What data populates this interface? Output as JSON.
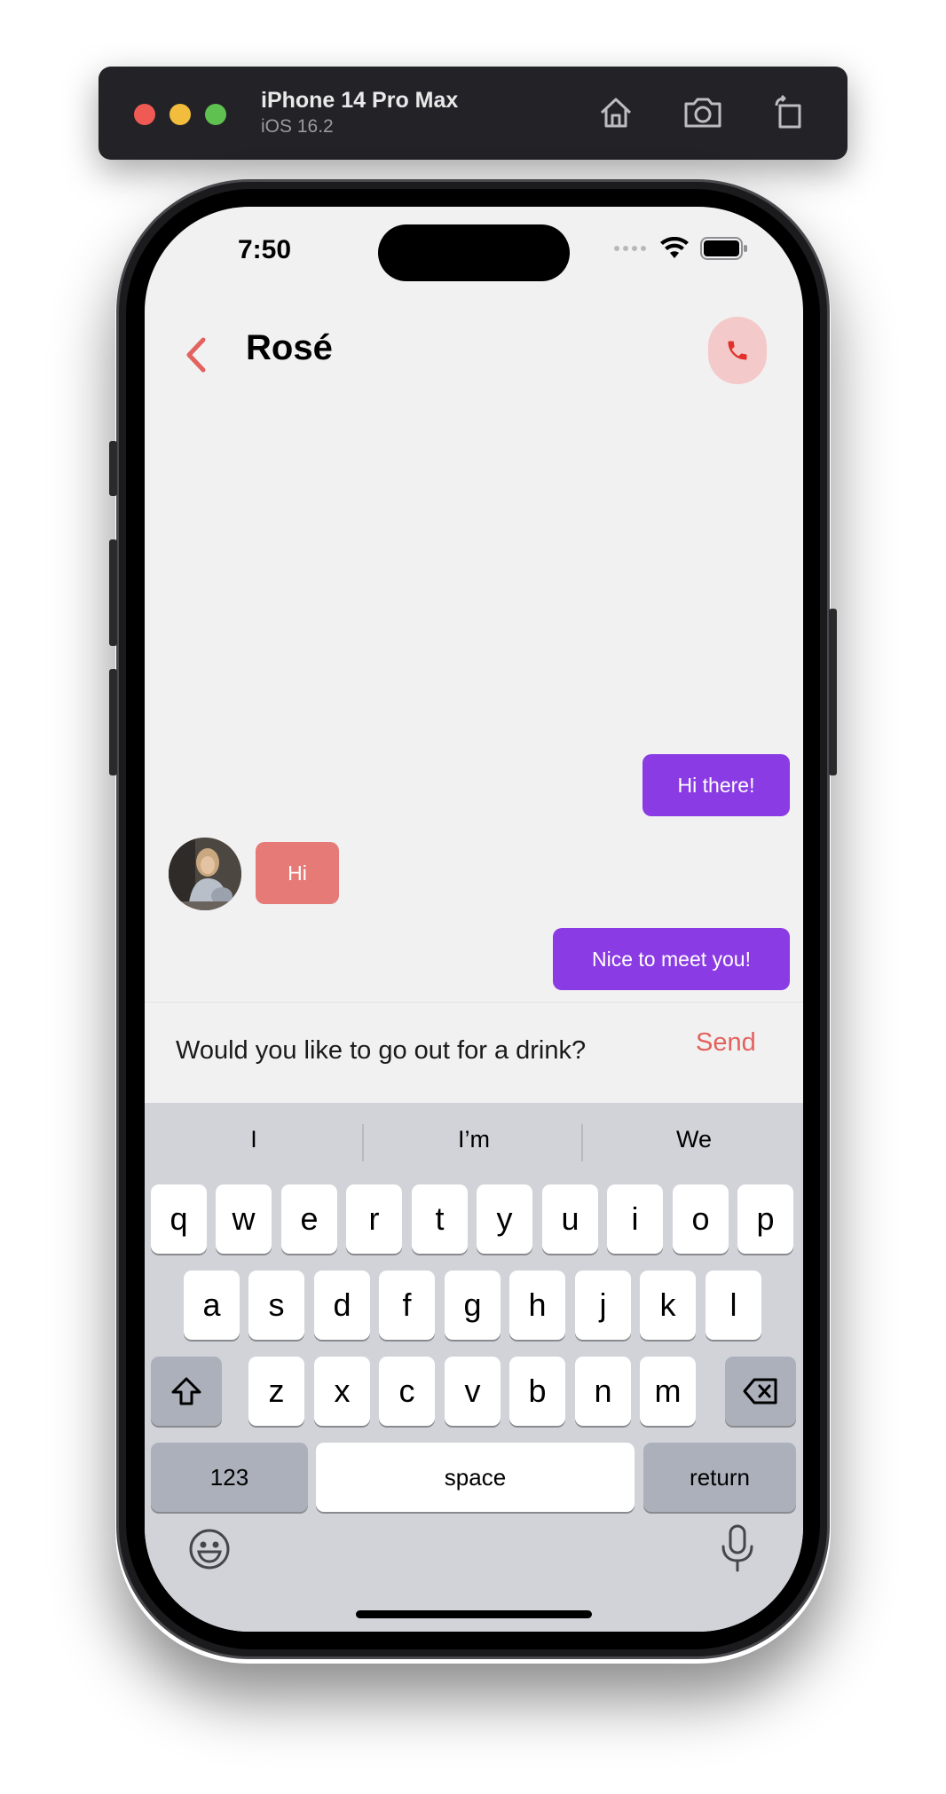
{
  "simulator": {
    "device": "iPhone 14 Pro Max",
    "os": "iOS 16.2",
    "buttons": [
      "home-icon",
      "screenshot-icon",
      "rotate-icon"
    ]
  },
  "status_bar": {
    "time": "7:50"
  },
  "nav": {
    "title": "Rosé",
    "back_icon": "chevron-left-icon",
    "call_icon": "phone-icon"
  },
  "colors": {
    "accent": "#e2625e",
    "outgoing_bubble": "#8a3be3",
    "incoming_bubble": "#e67a76",
    "call_bg": "#f4c9c9"
  },
  "messages": [
    {
      "direction": "out",
      "text": "Hi there!"
    },
    {
      "direction": "in",
      "text": "Hi"
    },
    {
      "direction": "out",
      "text": "Nice to meet you!"
    }
  ],
  "composer": {
    "text": "Would you like to go out for a drink?",
    "send_label": "Send"
  },
  "keyboard": {
    "suggestions": [
      "I",
      "I’m",
      "We"
    ],
    "row1": [
      "q",
      "w",
      "e",
      "r",
      "t",
      "y",
      "u",
      "i",
      "o",
      "p"
    ],
    "row2": [
      "a",
      "s",
      "d",
      "f",
      "g",
      "h",
      "j",
      "k",
      "l"
    ],
    "row3": [
      "z",
      "x",
      "c",
      "v",
      "b",
      "n",
      "m"
    ],
    "numbers_label": "123",
    "space_label": "space",
    "return_label": "return",
    "shift_icon": "shift-icon",
    "delete_icon": "delete-icon",
    "emoji_icon": "emoji-icon",
    "mic_icon": "microphone-icon"
  }
}
